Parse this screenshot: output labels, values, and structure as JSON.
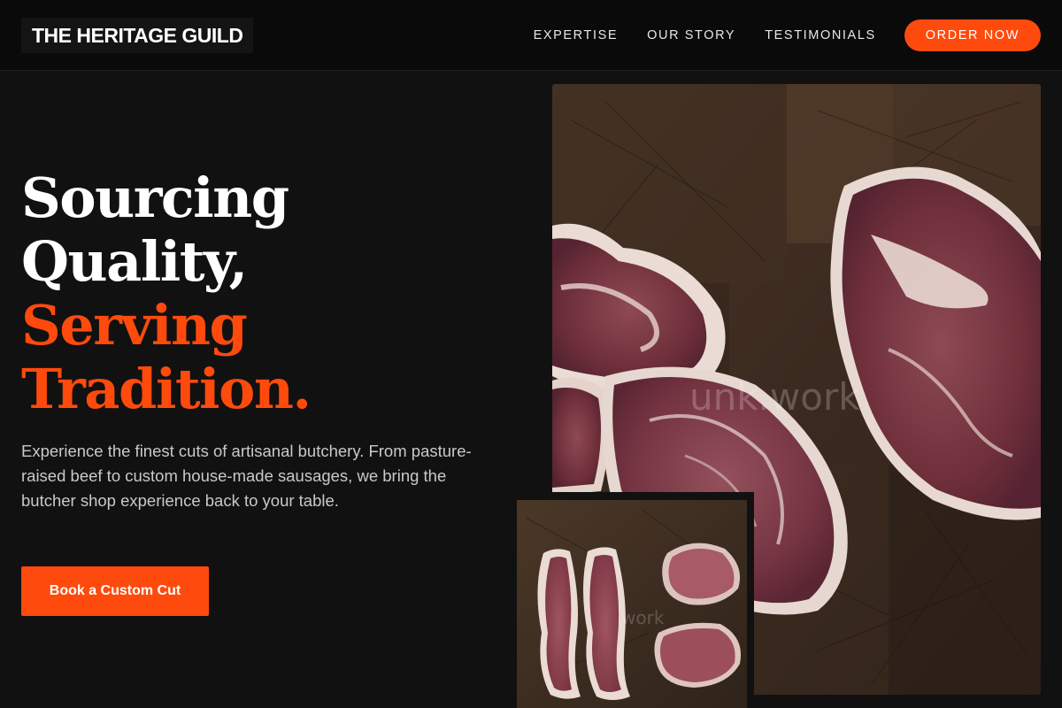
{
  "brand": {
    "name": "THE HERITAGE GUILD"
  },
  "nav": {
    "links": [
      "EXPERTISE",
      "OUR STORY",
      "TESTIMONIALS"
    ],
    "cta_label": "ORDER NOW"
  },
  "hero": {
    "headline_line1": "Sourcing",
    "headline_line2": "Quality,",
    "headline_accent_line1": "Serving",
    "headline_accent_line2": "Tradition.",
    "lead": "Experience the finest cuts of artisanal butchery. From pasture-raised beef to custom house-made sausages, we bring the butcher shop experience back to your table.",
    "cta_label": "Book a Custom Cut"
  },
  "colors": {
    "accent": "#ff4a0d",
    "background": "#111111",
    "header_background": "#0a0a0a"
  }
}
